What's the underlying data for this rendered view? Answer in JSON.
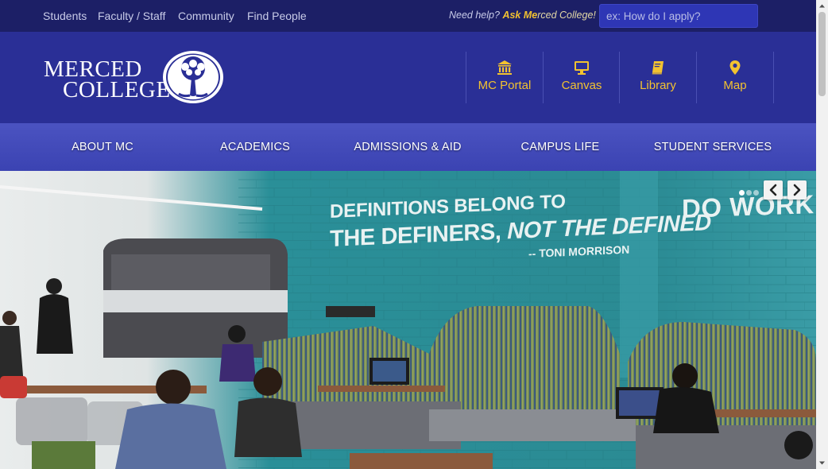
{
  "topbar": {
    "links": [
      "Students",
      "Faculty / Staff",
      "Community",
      "Find People"
    ],
    "help_prefix": "Need help?",
    "help_ask": "Ask Me",
    "help_rest": "rced College!",
    "search_placeholder": "ex: How do I apply?"
  },
  "header": {
    "logo_line1": "MERCED",
    "logo_line2": "COLLEGE",
    "quick_links": [
      {
        "label": "MC Portal",
        "icon": "bank-icon"
      },
      {
        "label": "Canvas",
        "icon": "monitor-icon"
      },
      {
        "label": "Library",
        "icon": "book-icon"
      },
      {
        "label": "Map",
        "icon": "map-pin-icon"
      }
    ]
  },
  "nav": {
    "items": [
      "ABOUT MC",
      "ACADEMICS",
      "ADMISSIONS & AID",
      "CAMPUS LIFE",
      "STUDENT SERVICES"
    ]
  },
  "hero": {
    "quote_line1": "DEFINITIONS BELONG TO",
    "quote_line2a": "THE DEFINERS, ",
    "quote_line2b": "NOT THE DEFINED",
    "quote_author": "-- TONI MORRISON",
    "wall_text": "DO WORK",
    "slide_count": 3,
    "active_slide": 1
  },
  "colors": {
    "topbar": "#1c1f66",
    "header": "#2a2f96",
    "nav": "#434bba",
    "accent": "#f2c230",
    "hero_wall": "#2c8a93"
  }
}
